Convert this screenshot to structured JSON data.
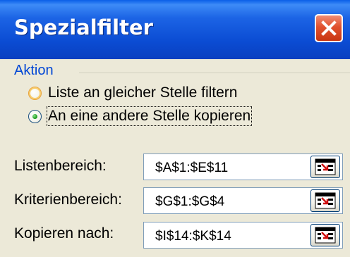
{
  "dialog": {
    "title": "Spezialfilter"
  },
  "group": {
    "title": "Aktion",
    "options": [
      {
        "label": "Liste an gleicher Stelle filtern",
        "selected": false
      },
      {
        "label": "An eine andere Stelle kopieren",
        "selected": true
      }
    ]
  },
  "fields": {
    "listenbereich": {
      "label": "Listenbereich:",
      "value": "$A$1:$E$11"
    },
    "kriterienbereich": {
      "label": "Kriterienbereich:",
      "value": "$G$1:$G$4"
    },
    "kopieren_nach": {
      "label": "Kopieren nach:",
      "value": "$I$14:$K$14"
    }
  },
  "icons": {
    "close": "close-icon",
    "range_picker": "range-select-icon"
  },
  "colors": {
    "title_bar": "#0B4CD3",
    "close_button": "#E1512E",
    "group_title": "#0046D5",
    "dialog_bg": "#ECE9D8"
  }
}
